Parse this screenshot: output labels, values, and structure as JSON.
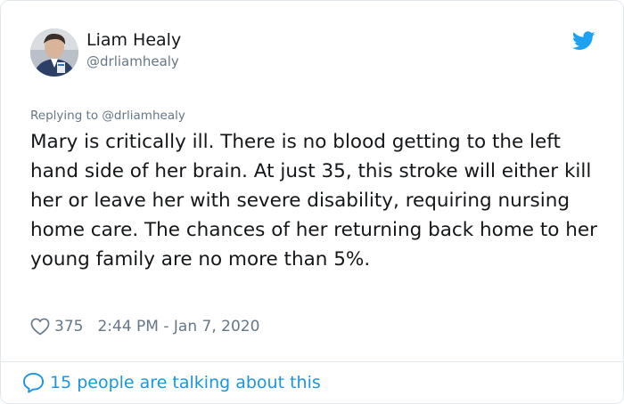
{
  "author": {
    "name": "Liam Healy",
    "handle": "@drliamhealy"
  },
  "reply": {
    "prefix": "Replying to ",
    "handle": "@drliamhealy"
  },
  "tweet": {
    "text": "Mary is critically ill. There is no blood getting to the left hand side of her brain. At just 35, this stroke will either kill her or leave her with severe disability, requiring nursing home care. The chances of her returning back home to her young family are no more than 5%."
  },
  "meta": {
    "likes": "375",
    "timestamp": "2:44 PM - Jan 7, 2020"
  },
  "footer": {
    "talking": "15 people are talking about this"
  },
  "icons": {
    "like": "heart-icon",
    "brand": "twitter-bird-icon",
    "conversation": "speech-bubble-icon"
  },
  "colors": {
    "brand": "#1da1f2",
    "link": "#1b95e0",
    "secondary_text": "#657786",
    "divider": "#e1e8ed"
  }
}
